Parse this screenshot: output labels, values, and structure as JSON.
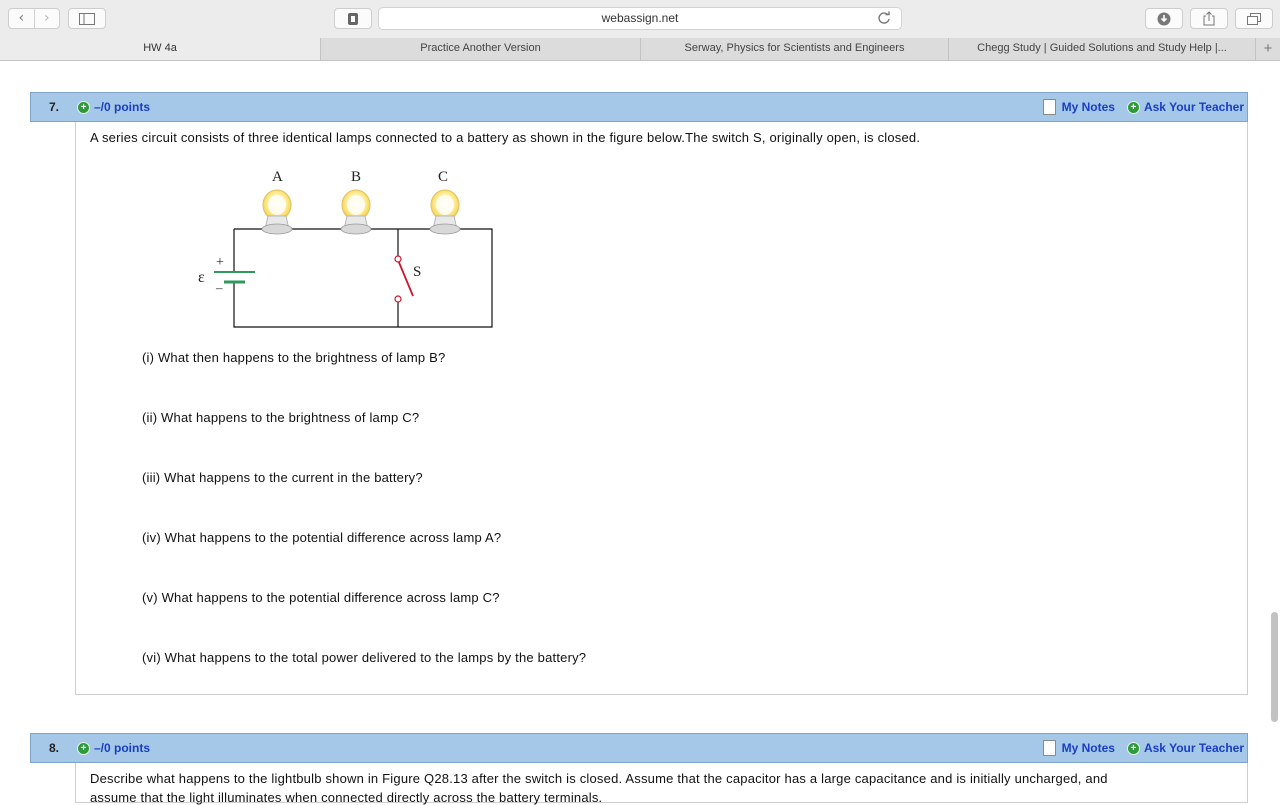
{
  "browser": {
    "url": "webassign.net",
    "tabs": [
      {
        "label": "HW 4a",
        "active": true
      },
      {
        "label": "Practice Another Version",
        "active": false
      },
      {
        "label": "Serway, Physics for Scientists and Engineers",
        "active": false
      },
      {
        "label": "Chegg Study | Guided Solutions and Study Help |...",
        "active": false
      }
    ]
  },
  "questions": [
    {
      "number": "7.",
      "points": "–/0 points",
      "my_notes": "My Notes",
      "ask_teacher": "Ask Your Teacher",
      "prompt": "A series circuit consists of three identical lamps connected to a battery as shown in the figure below.The switch S, originally open, is closed.",
      "figure": {
        "lamp_labels": [
          "A",
          "B",
          "C"
        ],
        "switch_label": "S",
        "emf_label": "ε",
        "plus_label": "+",
        "minus_label": "–"
      },
      "subquestions": [
        "(i) What then happens to the brightness of lamp B?",
        "(ii) What happens to the brightness of lamp C?",
        "(iii) What happens to the current in the battery?",
        "(iv) What happens to the potential difference across lamp A?",
        "(v) What happens to the potential difference across lamp C?",
        "(vi) What happens to the total power delivered to the lamps by the battery?"
      ]
    },
    {
      "number": "8.",
      "points": "–/0 points",
      "my_notes": "My Notes",
      "ask_teacher": "Ask Your Teacher",
      "prompt_line1": "Describe what happens to the lightbulb shown in Figure Q28.13 after the switch is closed. Assume that the capacitor has a large capacitance and is initially uncharged, and",
      "prompt_line2": "assume that the light illuminates when connected directly across the battery terminals."
    }
  ],
  "colors": {
    "header_blue": "#a6c8e8",
    "link_blue": "#1a3ec2",
    "battery_green": "#2e9a5a",
    "switch_red": "#d0142c"
  },
  "icons": [
    "back-icon",
    "forward-icon",
    "sidebar-icon",
    "evernote-icon",
    "reload-icon",
    "download-icon",
    "share-icon",
    "tabs-icon",
    "plus-icon",
    "note-icon"
  ]
}
